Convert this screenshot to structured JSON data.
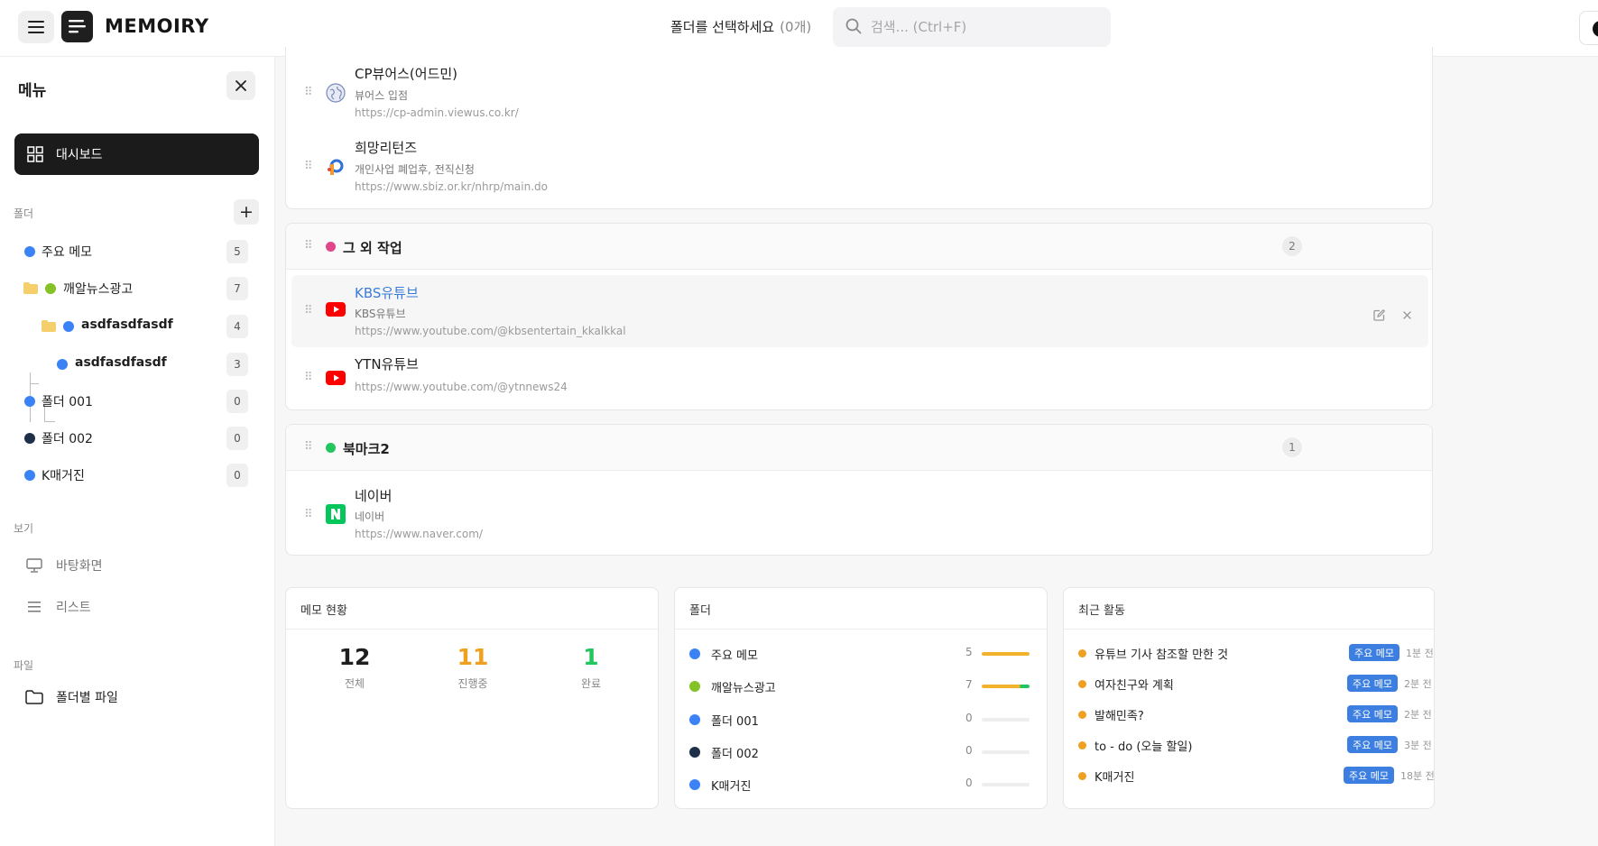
{
  "app": {
    "name": "MEMOIRY"
  },
  "header": {
    "folder_select": "폴더를 선택하세요",
    "folder_count": "(0개)",
    "search_placeholder": "검색... (Ctrl+F)"
  },
  "sidebar": {
    "title": "메뉴",
    "dashboard_label": "대시보드",
    "folders_label": "폴더",
    "folders": [
      {
        "name": "주요 메모",
        "count": "5",
        "color": "#3b82f6"
      },
      {
        "name": "깨알뉴스광고",
        "count": "7",
        "color": "#84c225"
      },
      {
        "name": "asdfasdfasdf",
        "count": "4",
        "color": "#3b82f6"
      },
      {
        "name": "asdfasdfasdf",
        "count": "3",
        "color": "#3b82f6"
      },
      {
        "name": "폴더 001",
        "count": "0",
        "color": "#3b82f6"
      },
      {
        "name": "폴더 002",
        "count": "0",
        "color": "#1e2f4a"
      },
      {
        "name": "K매거진",
        "count": "0",
        "color": "#3b82f6"
      }
    ],
    "view_label": "보기",
    "views": [
      {
        "label": "바탕화면"
      },
      {
        "label": "리스트"
      }
    ],
    "files_label": "파일",
    "files_item": "폴더별 파일"
  },
  "groups": [
    {
      "name": "",
      "bookmarks": [
        {
          "title": "CP뷰어스(어드민)",
          "desc": "뷰어스 입점",
          "url": "https://cp-admin.viewus.co.kr/"
        },
        {
          "title": "희망리턴즈",
          "desc": "개인사업 폐업후, 전직신청",
          "url": "https://www.sbiz.or.kr/nhrp/main.do"
        }
      ]
    },
    {
      "name": "그 외 작업",
      "count": "2",
      "color": "#e0478a",
      "bookmarks": [
        {
          "title": "KBS유튜브",
          "desc": "KBS유튜브",
          "url": "https://www.youtube.com/@kbsentertain_kkalkkal"
        },
        {
          "title": "YTN유튜브",
          "desc": "",
          "url": "https://www.youtube.com/@ytnnews24"
        }
      ]
    },
    {
      "name": "북마크2",
      "count": "1",
      "color": "#22c55e",
      "bookmarks": [
        {
          "title": "네이버",
          "desc": "네이버",
          "url": "https://www.naver.com/"
        }
      ]
    }
  ],
  "stats": {
    "memo_title": "메모 현황",
    "total": {
      "value": "12",
      "label": "전체"
    },
    "in_progress": {
      "value": "11",
      "label": "진행중"
    },
    "done": {
      "value": "1",
      "label": "완료"
    },
    "folders_title": "폴더",
    "folders": [
      {
        "name": "주요 메모",
        "count": "5",
        "color": "#3b82f6",
        "fill_fraction": 1.0
      },
      {
        "name": "깨알뉴스광고",
        "count": "7",
        "color": "#84c225",
        "fill_fraction": 1.0
      },
      {
        "name": "폴더 001",
        "count": "0",
        "color": "#3b82f6",
        "fill_fraction": 0
      },
      {
        "name": "폴더 002",
        "count": "0",
        "color": "#1e2f4a",
        "fill_fraction": 0
      },
      {
        "name": "K매거진",
        "count": "0",
        "color": "#3b82f6",
        "fill_fraction": 0
      }
    ],
    "activity_title": "최근 활동",
    "activity": [
      {
        "name": "유튜브 기사 참조할 만한 것",
        "badge": "주요 메모",
        "time": "1분 전"
      },
      {
        "name": "여자친구와 계획",
        "badge": "주요 메모",
        "time": "2분 전"
      },
      {
        "name": "발해민족?",
        "badge": "주요 메모",
        "time": "2분 전"
      },
      {
        "name": "to - do (오늘 할일)",
        "badge": "주요 메모",
        "time": "3분 전"
      },
      {
        "name": "K매거진",
        "badge": "주요 메모",
        "time": "18분 전"
      }
    ]
  },
  "colors": {
    "accent": "#3d7fe0",
    "dark": "#1b1b1b",
    "in_progress": "#f0a020",
    "done": "#22c55e",
    "bar": "#f2b22b"
  }
}
